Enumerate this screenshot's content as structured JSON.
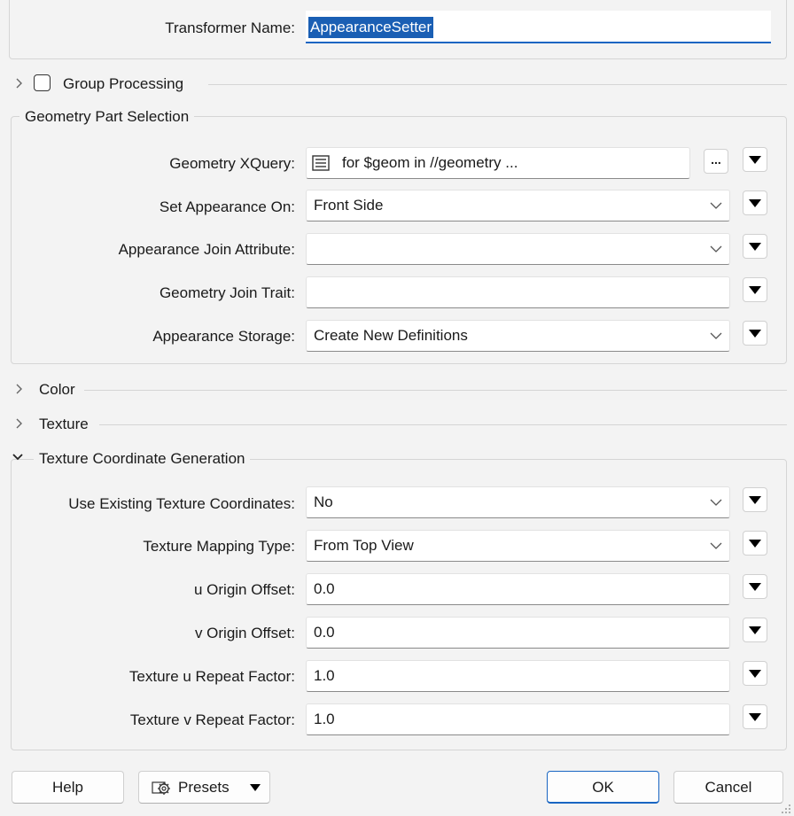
{
  "header": {
    "transformer_name_label": "Transformer Name:",
    "transformer_name_value": "AppearanceSetter"
  },
  "group_processing": {
    "label": "Group Processing",
    "checked": false
  },
  "geometry_part_selection": {
    "title": "Geometry Part Selection",
    "geometry_xquery_label": "Geometry XQuery:",
    "geometry_xquery_value": "for $geom in //geometry ...",
    "dots_label": "...",
    "set_appearance_on_label": "Set Appearance On:",
    "set_appearance_on_value": "Front Side",
    "appearance_join_attribute_label": "Appearance Join Attribute:",
    "appearance_join_attribute_value": "",
    "geometry_join_trait_label": "Geometry Join Trait:",
    "geometry_join_trait_value": "",
    "appearance_storage_label": "Appearance Storage:",
    "appearance_storage_value": "Create New Definitions"
  },
  "sections": {
    "color": "Color",
    "texture": "Texture",
    "texture_coordinate_generation": "Texture Coordinate Generation"
  },
  "texture_coords": {
    "use_existing_label": "Use Existing Texture Coordinates:",
    "use_existing_value": "No",
    "mapping_type_label": "Texture Mapping Type:",
    "mapping_type_value": "From Top View",
    "u_origin_label": "u Origin Offset:",
    "u_origin_value": "0.0",
    "v_origin_label": "v Origin Offset:",
    "v_origin_value": "0.0",
    "u_repeat_label": "Texture u Repeat Factor:",
    "u_repeat_value": "1.0",
    "v_repeat_label": "Texture v Repeat Factor:",
    "v_repeat_value": "1.0"
  },
  "footer": {
    "help": "Help",
    "presets": "Presets",
    "ok": "OK",
    "cancel": "Cancel"
  },
  "colors": {
    "accent": "#1865c2",
    "selection": "#1a5fb4"
  }
}
